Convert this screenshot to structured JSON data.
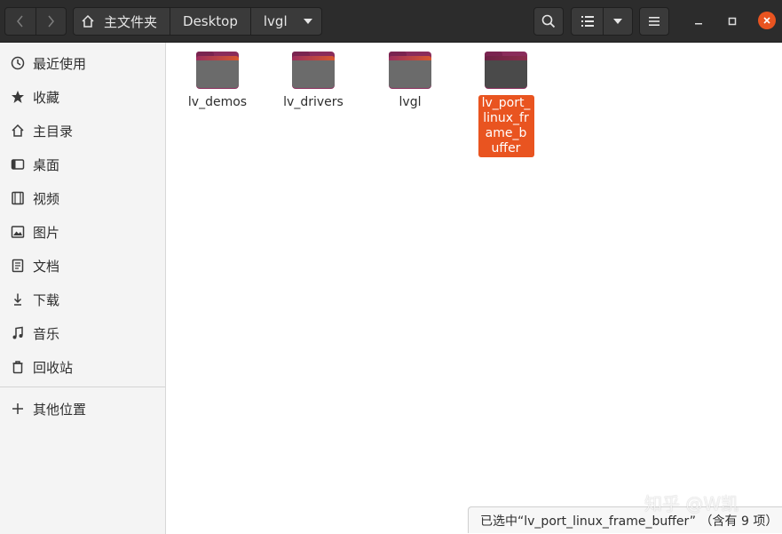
{
  "header": {
    "breadcrumbs": [
      "主文件夹",
      "Desktop",
      "lvgl"
    ],
    "icons": {
      "back": "chevron-left-icon",
      "forward": "chevron-right-icon",
      "home": "home-icon",
      "search": "search-icon",
      "list_view": "list-view-icon",
      "view_options": "triangle-down-icon",
      "menu": "hamburger-menu-icon",
      "minimize": "minimize-icon",
      "maximize": "maximize-icon",
      "close": "close-icon"
    }
  },
  "sidebar": {
    "items": [
      {
        "label": "最近使用",
        "icon": "clock-icon"
      },
      {
        "label": "收藏",
        "icon": "star-icon"
      },
      {
        "label": "主目录",
        "icon": "home-icon"
      },
      {
        "label": "桌面",
        "icon": "desktop-icon"
      },
      {
        "label": "视频",
        "icon": "film-icon"
      },
      {
        "label": "图片",
        "icon": "image-icon"
      },
      {
        "label": "文档",
        "icon": "document-icon"
      },
      {
        "label": "下载",
        "icon": "download-icon"
      },
      {
        "label": "音乐",
        "icon": "music-icon"
      },
      {
        "label": "回收站",
        "icon": "trash-icon"
      },
      {
        "label": "其他位置",
        "icon": "plus-icon"
      }
    ]
  },
  "files": [
    {
      "name": "lv_demos",
      "selected": false
    },
    {
      "name": "lv_drivers",
      "selected": false
    },
    {
      "name": "lvgl",
      "selected": false
    },
    {
      "name": "lv_port_linux_frame_buffer",
      "selected": true
    }
  ],
  "status": {
    "text": "已选中“lv_port_linux_frame_buffer” （含有 9 项）"
  },
  "watermark": "知乎 @W凯",
  "colors": {
    "accent": "#e95420",
    "headerbar": "#2c2c2c",
    "sidebar": "#f4f4f4"
  }
}
